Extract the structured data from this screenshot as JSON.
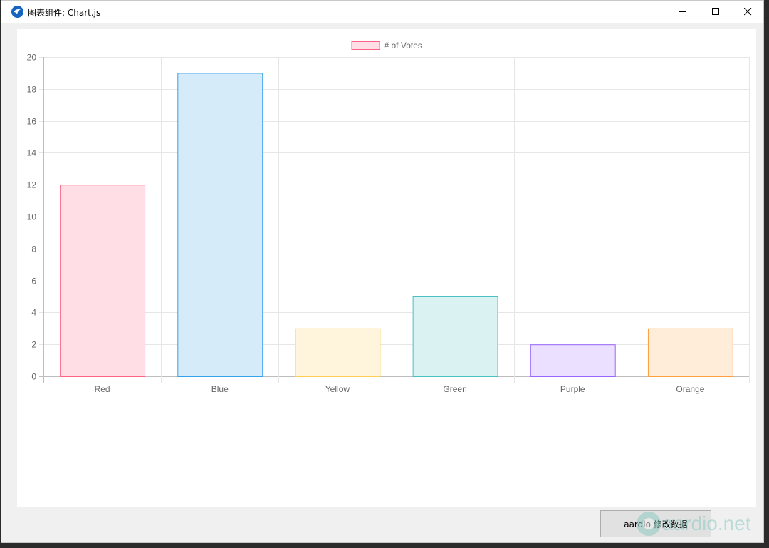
{
  "window": {
    "title": "图表组件: Chart.js"
  },
  "titlebar": {
    "minimize_icon": "minimize-icon",
    "maximize_icon": "maximize-icon",
    "close_icon": "close-icon"
  },
  "chart_data": {
    "type": "bar",
    "categories": [
      "Red",
      "Blue",
      "Yellow",
      "Green",
      "Purple",
      "Orange"
    ],
    "series": [
      {
        "name": "# of Votes",
        "values": [
          12,
          19,
          3,
          5,
          2,
          3
        ]
      }
    ],
    "bar_fill_colors": [
      "#ffdfe5",
      "#d5ebf9",
      "#fff4dc",
      "#dbf2f2",
      "#ebe0ff",
      "#ffecd9"
    ],
    "bar_border_colors": [
      "#ff6384",
      "#36a2eb",
      "#ffce56",
      "#4bc0c0",
      "#9966ff",
      "#ff9f40"
    ],
    "ylim": [
      0,
      20
    ],
    "y_ticks": [
      0,
      2,
      4,
      6,
      8,
      10,
      12,
      14,
      16,
      18,
      20
    ],
    "grid": true,
    "legend_position": "top"
  },
  "footer": {
    "button_label": "aardio 修改数据",
    "watermark_text": "aardio.net"
  }
}
